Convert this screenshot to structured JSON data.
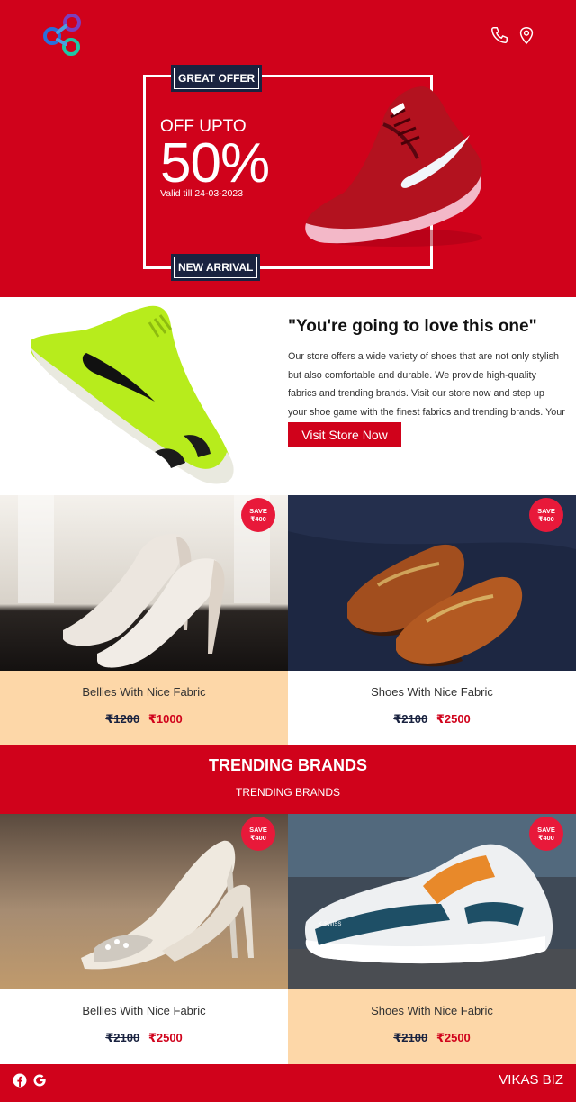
{
  "hero": {
    "great_offer": "GREAT OFFER",
    "new_arrival": "NEW ARRIVAL",
    "off_upto": "OFF UPTO",
    "percent": "50%",
    "valid": "Valid till 24-03-2023"
  },
  "icons": {
    "logo": "logo-icon",
    "phone": "phone-icon",
    "location": "location-pin-icon",
    "facebook": "facebook-icon",
    "google": "google-icon"
  },
  "feature": {
    "title": "\"You're going to love this one\"",
    "body": "Our store offers a wide variety of shoes that are not only stylish but also comfortable and durable. We provide high-quality fabrics and trending brands. Visit our store now and step up your shoe game with the finest fabrics and trending brands. Your feet will thank you!",
    "button": "Visit Store Now"
  },
  "save_badge": {
    "line1": "SAVE",
    "line2": "₹400"
  },
  "products_top": [
    {
      "name": "Bellies With Nice Fabric",
      "old_price": "₹1200",
      "new_price": "₹1000"
    },
    {
      "name": "Shoes With Nice Fabric",
      "old_price": "₹2100",
      "new_price": "₹2500"
    }
  ],
  "trending": {
    "title": "TRENDING BRANDS",
    "subtitle": "TRENDING BRANDS"
  },
  "products_bottom": [
    {
      "name": "Bellies With Nice Fabric",
      "old_price": "₹2100",
      "new_price": "₹2500"
    },
    {
      "name": "Shoes With Nice Fabric",
      "old_price": "₹2100",
      "new_price": "₹2500"
    }
  ],
  "footer": {
    "brand": "VIKAS BIZ"
  },
  "colors": {
    "primary_red": "#d0021b",
    "navy": "#1a2340",
    "peach": "#fdd7a8",
    "badge": "#e8193a"
  }
}
